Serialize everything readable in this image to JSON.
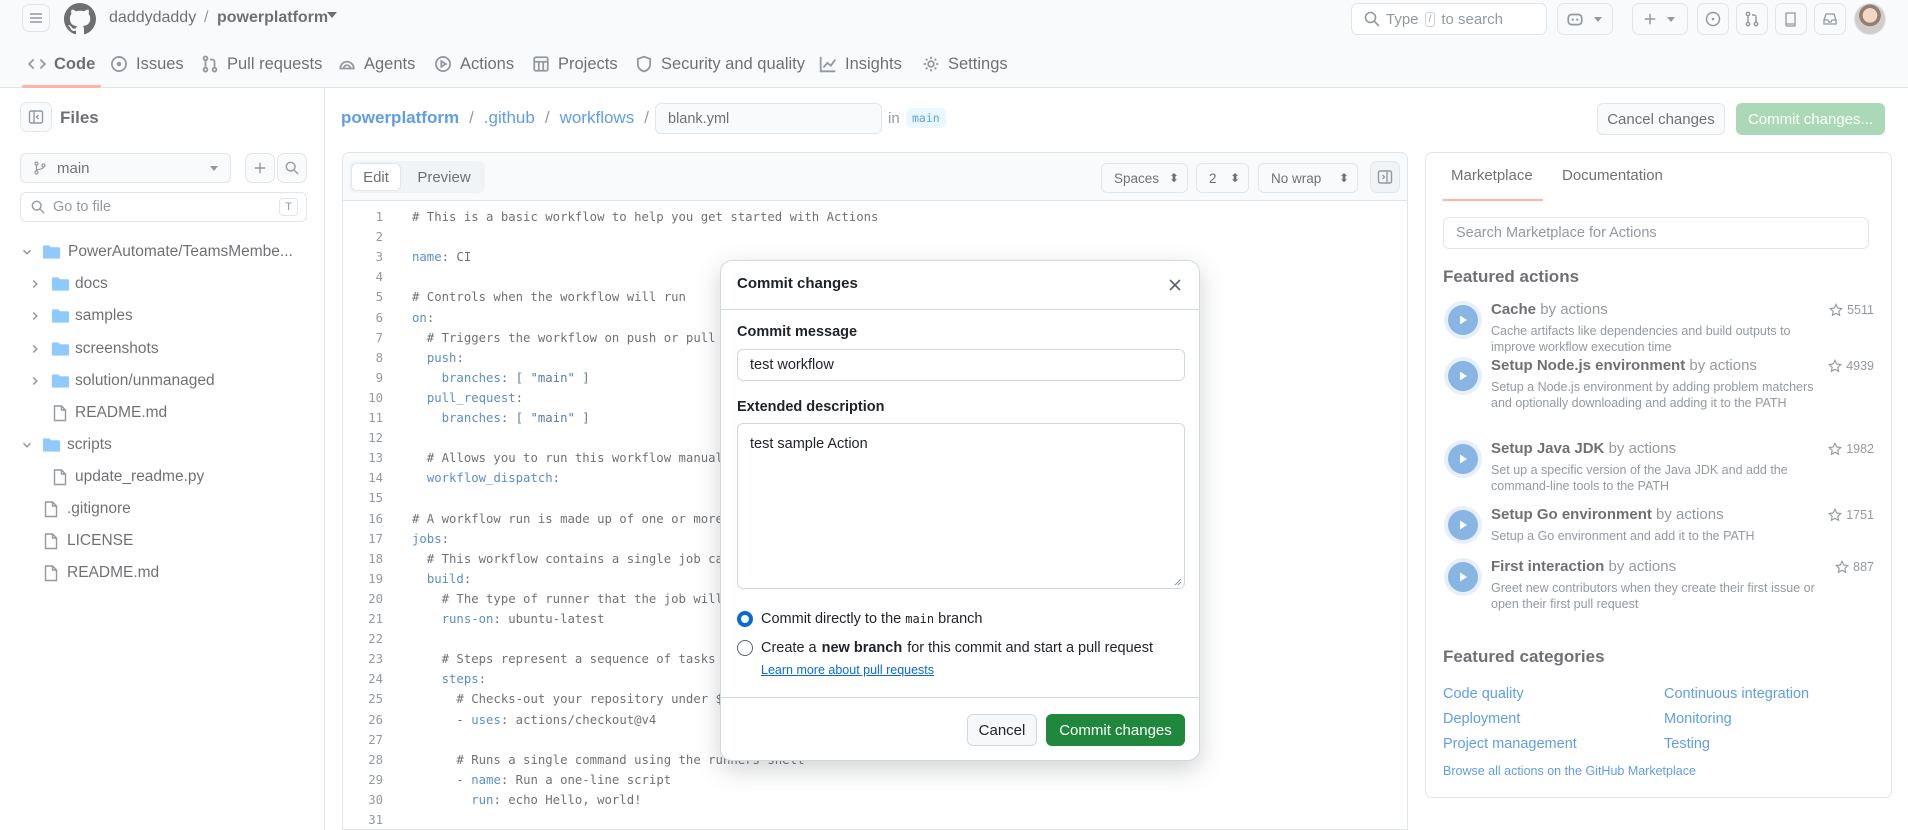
{
  "header": {
    "owner": "daddydaddy",
    "separator": "/",
    "repo": "powerplatform",
    "search_prefix": "Type",
    "search_key": "/",
    "search_suffix": "to search"
  },
  "tabs": [
    {
      "label": "Code",
      "icon": "code-icon"
    },
    {
      "label": "Issues",
      "icon": "issue-icon"
    },
    {
      "label": "Pull requests",
      "icon": "pull-request-icon"
    },
    {
      "label": "Agents",
      "icon": "agents-icon"
    },
    {
      "label": "Actions",
      "icon": "play-icon"
    },
    {
      "label": "Projects",
      "icon": "table-icon"
    },
    {
      "label": "Security and quality",
      "icon": "shield-icon"
    },
    {
      "label": "Insights",
      "icon": "graph-icon"
    },
    {
      "label": "Settings",
      "icon": "gear-icon"
    }
  ],
  "files": {
    "title": "Files",
    "branch": "main",
    "goto_placeholder": "Go to file",
    "goto_key": "T",
    "tree": [
      {
        "name": "PowerAutomate/TeamsMembe...",
        "type": "folder",
        "expanded": true
      },
      {
        "name": "docs",
        "type": "folder"
      },
      {
        "name": "samples",
        "type": "folder"
      },
      {
        "name": "screenshots",
        "type": "folder"
      },
      {
        "name": "solution/unmanaged",
        "type": "folder"
      },
      {
        "name": "README.md",
        "type": "file"
      },
      {
        "name": "scripts",
        "type": "folder",
        "expanded": true
      },
      {
        "name": "update_readme.py",
        "type": "file"
      },
      {
        "name": ".gitignore",
        "type": "file"
      },
      {
        "name": "LICENSE",
        "type": "file"
      },
      {
        "name": "README.md",
        "type": "file"
      }
    ]
  },
  "path": {
    "repo": "powerplatform",
    "sep": "/",
    "dir1": ".github",
    "dir2": "workflows",
    "filename": "blank.yml",
    "in_label": "in",
    "branch": "main"
  },
  "actions": {
    "cancel": "Cancel changes",
    "commit": "Commit changes..."
  },
  "editor": {
    "edit_tab": "Edit",
    "preview_tab": "Preview",
    "indent_mode": "Spaces",
    "indent_size": "2",
    "wrap_mode": "No wrap",
    "lines": [
      {
        "n": "1",
        "t": "# This is a basic workflow to help you get started with Actions"
      },
      {
        "n": "2",
        "t": ""
      },
      {
        "n": "3",
        "t": "name: CI"
      },
      {
        "n": "4",
        "t": ""
      },
      {
        "n": "5",
        "t": "# Controls when the workflow will run"
      },
      {
        "n": "6",
        "t": "on:"
      },
      {
        "n": "7",
        "t": "  # Triggers the workflow on push or pull r"
      },
      {
        "n": "8",
        "t": "  push:"
      },
      {
        "n": "9",
        "t": "    branches: [ \"main\" ]"
      },
      {
        "n": "10",
        "t": "  pull_request:"
      },
      {
        "n": "11",
        "t": "    branches: [ \"main\" ]"
      },
      {
        "n": "12",
        "t": ""
      },
      {
        "n": "13",
        "t": "  # Allows you to run this workflow manuall"
      },
      {
        "n": "14",
        "t": "  workflow_dispatch:"
      },
      {
        "n": "15",
        "t": ""
      },
      {
        "n": "16",
        "t": "# A workflow run is made up of one or more"
      },
      {
        "n": "17",
        "t": "jobs:"
      },
      {
        "n": "18",
        "t": "  # This workflow contains a single job cal"
      },
      {
        "n": "19",
        "t": "  build:"
      },
      {
        "n": "20",
        "t": "    # The type of runner that the job will"
      },
      {
        "n": "21",
        "t": "    runs-on: ubuntu-latest"
      },
      {
        "n": "22",
        "t": ""
      },
      {
        "n": "23",
        "t": "    # Steps represent a sequence of tasks t"
      },
      {
        "n": "24",
        "t": "    steps:"
      },
      {
        "n": "25",
        "t": "      # Checks-out your repository under $G"
      },
      {
        "n": "26",
        "t": "      - uses: actions/checkout@v4"
      },
      {
        "n": "27",
        "t": ""
      },
      {
        "n": "28",
        "t": "      # Runs a single command using the runners shell"
      },
      {
        "n": "29",
        "t": "      - name: Run a one-line script"
      },
      {
        "n": "30",
        "t": "        run: echo Hello, world!"
      },
      {
        "n": "31",
        "t": ""
      }
    ]
  },
  "marketplace": {
    "tab_marketplace": "Marketplace",
    "tab_documentation": "Documentation",
    "search_placeholder": "Search Marketplace for Actions",
    "featured_actions_title": "Featured actions",
    "items": [
      {
        "name": "Cache",
        "by": "by actions",
        "stars": "5511",
        "desc": "Cache artifacts like dependencies and build outputs to improve workflow execution time"
      },
      {
        "name": "Setup Node.js environment",
        "by": "by actions",
        "stars": "4939",
        "desc": "Setup a Node.js environment by adding problem matchers and optionally downloading and adding it to the PATH"
      },
      {
        "name": "Setup Java JDK",
        "by": "by actions",
        "stars": "1982",
        "desc": "Set up a specific version of the Java JDK and add the command-line tools to the PATH"
      },
      {
        "name": "Setup Go environment",
        "by": "by actions",
        "stars": "1751",
        "desc": "Setup a Go environment and add it to the PATH"
      },
      {
        "name": "First interaction",
        "by": "by actions",
        "stars": "887",
        "desc": "Greet new contributors when they create their first issue or open their first pull request"
      }
    ],
    "featured_categories_title": "Featured categories",
    "categories": [
      "Code quality",
      "Continuous integration",
      "Deployment",
      "Monitoring",
      "Project management",
      "Testing"
    ],
    "browse_link": "Browse all actions on the GitHub Marketplace"
  },
  "modal": {
    "title": "Commit changes",
    "message_label": "Commit message",
    "message_value": "test workflow",
    "description_label": "Extended description",
    "description_value": "test sample Action",
    "option1_pre": "Commit directly to the",
    "option1_branch": "main",
    "option1_post": "branch",
    "option2_pre": "Create a",
    "option2_bold": "new branch",
    "option2_post": "for this commit and start a pull request",
    "learn_more": "Learn more about pull requests",
    "cancel": "Cancel",
    "submit": "Commit changes"
  },
  "colors": {
    "primary_green": "#1f883d",
    "link_blue": "#0969da",
    "tab_underline": "#fd8c73"
  }
}
